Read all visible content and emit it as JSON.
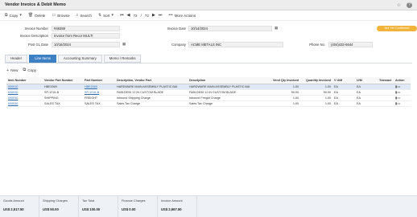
{
  "window": {
    "title": "Vendor Invoice & Debit Memo"
  },
  "toolbar": {
    "copy_label": "Copy",
    "delete_label": "Delete",
    "browse_label": "Browse",
    "search_label": "Search",
    "sort_label": "Sort",
    "pager_current": "72",
    "pager_sep": "/",
    "pager_total": "72",
    "more_actions_label": "More Actions"
  },
  "form": {
    "invoice_number_label": "Invoice Number",
    "invoice_number_value": "#48359",
    "invoice_description_label": "Invoice Description",
    "invoice_description_value": "Invoice from Recor MULTI",
    "post_gl_date_label": "Post GL Date",
    "post_gl_date_value": "10/16/2024",
    "invoice_date_label": "Invoice Date",
    "invoice_date_value": "10/14/2024",
    "company_label": "Company",
    "company_value": "ACME METALS INC",
    "phone_label": "Phone No.",
    "phone_value": "(404)432-6644",
    "status_label": "Not Yet Confirmed"
  },
  "tabs": [
    {
      "label": "Header"
    },
    {
      "label": "Line Items"
    },
    {
      "label": "Accounting Summary"
    },
    {
      "label": "Memo / Remarks"
    }
  ],
  "line_items": {
    "new_label": "New",
    "copy_label": "Copy",
    "columns": [
      "Item Number",
      "Vendor Part Number",
      "Part Number",
      "Description, Vendor Part",
      "Description",
      "Vend Qty Invoiced",
      "Quantity Invoiced",
      "V U/M",
      "U/M",
      "Transact",
      "Action"
    ],
    "rows": [
      {
        "item": "000010",
        "vendor_part": "HBE2069",
        "part": "HBE2069",
        "desc_vendor": "HARDWARE MAIN ASSEMBLY PLASTIC BAI",
        "desc": "HARDWARE MAIN ASSEMBLY PLASTIC BAI",
        "vend_qty": "1.00",
        "qty": "1.00",
        "vum": "EA",
        "um": "EA",
        "transact": "",
        "selected": true
      },
      {
        "item": "000020",
        "vendor_part": "SP-1215-B",
        "part": "SP-1215-B",
        "desc_vendor": "FABLDE06 12 IN CUSTOM BLADE",
        "desc": "FABLDE06 12 IN CUSTOM BLADE",
        "vend_qty": "50.00",
        "qty": "50.00",
        "vum": "EA",
        "um": "EA",
        "transact": "",
        "selected": false
      },
      {
        "item": "000030",
        "vendor_part": "SHIPPING",
        "part": "FREIGHT",
        "desc_vendor": "Inbound Shipping Charge",
        "desc": "Inbound Freight Charge",
        "vend_qty": "1.00",
        "qty": "1.00",
        "vum": "EA",
        "um": "EA",
        "transact": "",
        "selected": false
      },
      {
        "item": "000040",
        "vendor_part": "SALES TAX",
        "part": "SALES TAX",
        "desc_vendor": "Sales Tax Charge",
        "desc": "Sales Tax Charge",
        "vend_qty": "1.00",
        "qty": "1.00",
        "vum": "EA",
        "um": "EA",
        "transact": "",
        "selected": false
      }
    ]
  },
  "totals": [
    {
      "label": "Goods Amount",
      "value": "US$ 2,517.50"
    },
    {
      "label": "Shipping Charges",
      "value": "US$ 50.00"
    },
    {
      "label": "Tax Total",
      "value": "US$ 100.00"
    },
    {
      "label": "Finance Charges",
      "value": "US$ 0.00"
    },
    {
      "label": "Invoice Amount",
      "value": "US$ 2,667.50"
    }
  ],
  "colors": {
    "accent": "#3d7fc3",
    "status": "#f2b33a",
    "selected_row": "#dfe8f6"
  },
  "icons": [
    "copy-icon",
    "delete-icon",
    "browse-icon",
    "search-icon",
    "sort-icon",
    "first-page-icon",
    "prev-page-icon",
    "next-page-icon",
    "last-page-icon",
    "more-actions-icon",
    "calendar-icon",
    "star-icon",
    "help-icon",
    "new-icon"
  ]
}
